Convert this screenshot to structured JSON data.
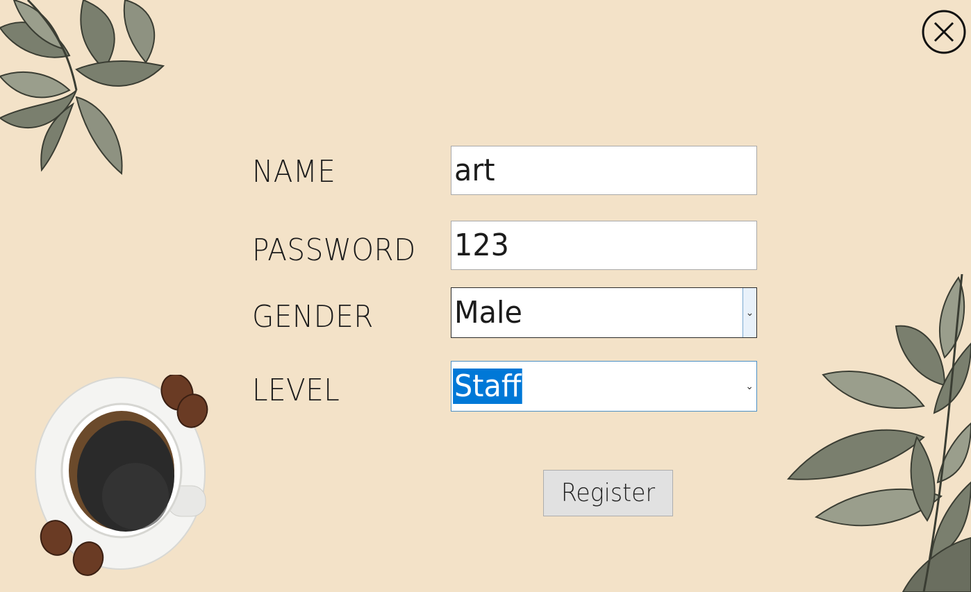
{
  "form": {
    "name_label": "NAME",
    "name_value": "art",
    "password_label": "PASSWORD",
    "password_value": "123",
    "gender_label": "GENDER",
    "gender_value": "Male",
    "level_label": "LEVEL",
    "level_value": "Staff",
    "register_label": "Register"
  },
  "icons": {
    "close": "close-icon",
    "dropdown": "chevron-down-icon",
    "leaves": "coffee-leaves-decoration",
    "cup": "coffee-cup-decoration"
  },
  "colors": {
    "background": "#f3e2c8",
    "selection": "#0078d7",
    "leaf": "#6f7465"
  }
}
